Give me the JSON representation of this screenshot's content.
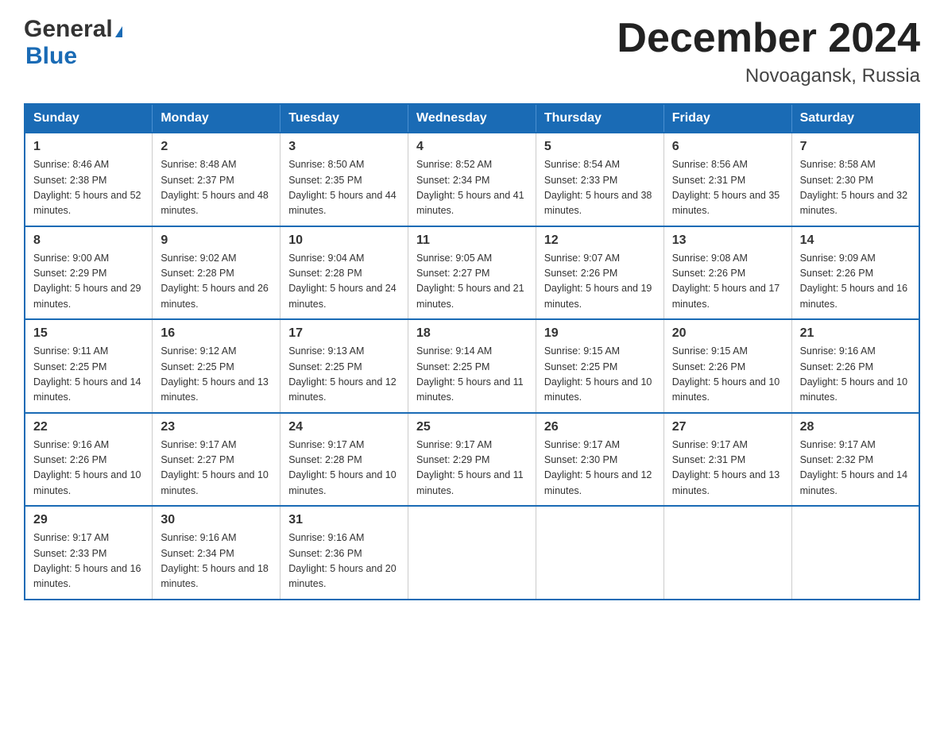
{
  "header": {
    "logo_general": "General",
    "logo_blue": "Blue",
    "month_title": "December 2024",
    "location": "Novoagansk, Russia"
  },
  "weekdays": [
    "Sunday",
    "Monday",
    "Tuesday",
    "Wednesday",
    "Thursday",
    "Friday",
    "Saturday"
  ],
  "weeks": [
    [
      {
        "day": "1",
        "sunrise": "Sunrise: 8:46 AM",
        "sunset": "Sunset: 2:38 PM",
        "daylight": "Daylight: 5 hours and 52 minutes."
      },
      {
        "day": "2",
        "sunrise": "Sunrise: 8:48 AM",
        "sunset": "Sunset: 2:37 PM",
        "daylight": "Daylight: 5 hours and 48 minutes."
      },
      {
        "day": "3",
        "sunrise": "Sunrise: 8:50 AM",
        "sunset": "Sunset: 2:35 PM",
        "daylight": "Daylight: 5 hours and 44 minutes."
      },
      {
        "day": "4",
        "sunrise": "Sunrise: 8:52 AM",
        "sunset": "Sunset: 2:34 PM",
        "daylight": "Daylight: 5 hours and 41 minutes."
      },
      {
        "day": "5",
        "sunrise": "Sunrise: 8:54 AM",
        "sunset": "Sunset: 2:33 PM",
        "daylight": "Daylight: 5 hours and 38 minutes."
      },
      {
        "day": "6",
        "sunrise": "Sunrise: 8:56 AM",
        "sunset": "Sunset: 2:31 PM",
        "daylight": "Daylight: 5 hours and 35 minutes."
      },
      {
        "day": "7",
        "sunrise": "Sunrise: 8:58 AM",
        "sunset": "Sunset: 2:30 PM",
        "daylight": "Daylight: 5 hours and 32 minutes."
      }
    ],
    [
      {
        "day": "8",
        "sunrise": "Sunrise: 9:00 AM",
        "sunset": "Sunset: 2:29 PM",
        "daylight": "Daylight: 5 hours and 29 minutes."
      },
      {
        "day": "9",
        "sunrise": "Sunrise: 9:02 AM",
        "sunset": "Sunset: 2:28 PM",
        "daylight": "Daylight: 5 hours and 26 minutes."
      },
      {
        "day": "10",
        "sunrise": "Sunrise: 9:04 AM",
        "sunset": "Sunset: 2:28 PM",
        "daylight": "Daylight: 5 hours and 24 minutes."
      },
      {
        "day": "11",
        "sunrise": "Sunrise: 9:05 AM",
        "sunset": "Sunset: 2:27 PM",
        "daylight": "Daylight: 5 hours and 21 minutes."
      },
      {
        "day": "12",
        "sunrise": "Sunrise: 9:07 AM",
        "sunset": "Sunset: 2:26 PM",
        "daylight": "Daylight: 5 hours and 19 minutes."
      },
      {
        "day": "13",
        "sunrise": "Sunrise: 9:08 AM",
        "sunset": "Sunset: 2:26 PM",
        "daylight": "Daylight: 5 hours and 17 minutes."
      },
      {
        "day": "14",
        "sunrise": "Sunrise: 9:09 AM",
        "sunset": "Sunset: 2:26 PM",
        "daylight": "Daylight: 5 hours and 16 minutes."
      }
    ],
    [
      {
        "day": "15",
        "sunrise": "Sunrise: 9:11 AM",
        "sunset": "Sunset: 2:25 PM",
        "daylight": "Daylight: 5 hours and 14 minutes."
      },
      {
        "day": "16",
        "sunrise": "Sunrise: 9:12 AM",
        "sunset": "Sunset: 2:25 PM",
        "daylight": "Daylight: 5 hours and 13 minutes."
      },
      {
        "day": "17",
        "sunrise": "Sunrise: 9:13 AM",
        "sunset": "Sunset: 2:25 PM",
        "daylight": "Daylight: 5 hours and 12 minutes."
      },
      {
        "day": "18",
        "sunrise": "Sunrise: 9:14 AM",
        "sunset": "Sunset: 2:25 PM",
        "daylight": "Daylight: 5 hours and 11 minutes."
      },
      {
        "day": "19",
        "sunrise": "Sunrise: 9:15 AM",
        "sunset": "Sunset: 2:25 PM",
        "daylight": "Daylight: 5 hours and 10 minutes."
      },
      {
        "day": "20",
        "sunrise": "Sunrise: 9:15 AM",
        "sunset": "Sunset: 2:26 PM",
        "daylight": "Daylight: 5 hours and 10 minutes."
      },
      {
        "day": "21",
        "sunrise": "Sunrise: 9:16 AM",
        "sunset": "Sunset: 2:26 PM",
        "daylight": "Daylight: 5 hours and 10 minutes."
      }
    ],
    [
      {
        "day": "22",
        "sunrise": "Sunrise: 9:16 AM",
        "sunset": "Sunset: 2:26 PM",
        "daylight": "Daylight: 5 hours and 10 minutes."
      },
      {
        "day": "23",
        "sunrise": "Sunrise: 9:17 AM",
        "sunset": "Sunset: 2:27 PM",
        "daylight": "Daylight: 5 hours and 10 minutes."
      },
      {
        "day": "24",
        "sunrise": "Sunrise: 9:17 AM",
        "sunset": "Sunset: 2:28 PM",
        "daylight": "Daylight: 5 hours and 10 minutes."
      },
      {
        "day": "25",
        "sunrise": "Sunrise: 9:17 AM",
        "sunset": "Sunset: 2:29 PM",
        "daylight": "Daylight: 5 hours and 11 minutes."
      },
      {
        "day": "26",
        "sunrise": "Sunrise: 9:17 AM",
        "sunset": "Sunset: 2:30 PM",
        "daylight": "Daylight: 5 hours and 12 minutes."
      },
      {
        "day": "27",
        "sunrise": "Sunrise: 9:17 AM",
        "sunset": "Sunset: 2:31 PM",
        "daylight": "Daylight: 5 hours and 13 minutes."
      },
      {
        "day": "28",
        "sunrise": "Sunrise: 9:17 AM",
        "sunset": "Sunset: 2:32 PM",
        "daylight": "Daylight: 5 hours and 14 minutes."
      }
    ],
    [
      {
        "day": "29",
        "sunrise": "Sunrise: 9:17 AM",
        "sunset": "Sunset: 2:33 PM",
        "daylight": "Daylight: 5 hours and 16 minutes."
      },
      {
        "day": "30",
        "sunrise": "Sunrise: 9:16 AM",
        "sunset": "Sunset: 2:34 PM",
        "daylight": "Daylight: 5 hours and 18 minutes."
      },
      {
        "day": "31",
        "sunrise": "Sunrise: 9:16 AM",
        "sunset": "Sunset: 2:36 PM",
        "daylight": "Daylight: 5 hours and 20 minutes."
      },
      null,
      null,
      null,
      null
    ]
  ]
}
